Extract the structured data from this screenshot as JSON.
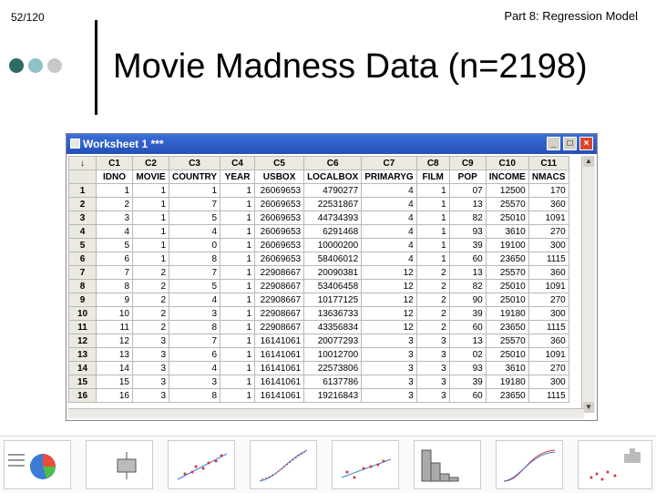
{
  "slide": {
    "number": "52/120",
    "part_title": "Part 8: Regression Model",
    "title": "Movie Madness Data (n=2198)"
  },
  "colors": {
    "dot1": "#2e6b64",
    "dot2": "#8cc2c7",
    "dot3": "#c8c8c8",
    "titlebar": "#2a56c0"
  },
  "worksheet": {
    "title": "Worksheet 1 ***",
    "buttons": {
      "minimize": "_",
      "maximize": "□",
      "close": "×"
    },
    "row_header_arrow": "↓",
    "columns": [
      "C1",
      "C2",
      "C3",
      "C4",
      "C5",
      "C6",
      "C7",
      "C8",
      "C9",
      "C10",
      "C11"
    ],
    "names": [
      "IDNO",
      "MOVIE",
      "COUNTRY",
      "YEAR",
      "USBOX",
      "LOCALBOX",
      "PRIMARYG",
      "FILM",
      "POP",
      "INCOME",
      "NMACS"
    ],
    "rows": [
      [
        "1",
        "1",
        "1",
        "1",
        "1",
        "26069653",
        "4790277",
        "4",
        "1",
        "07",
        "12500",
        "170"
      ],
      [
        "2",
        "2",
        "1",
        "7",
        "1",
        "26069653",
        "22531867",
        "4",
        "1",
        "13",
        "25570",
        "360"
      ],
      [
        "3",
        "3",
        "1",
        "5",
        "1",
        "26069653",
        "44734393",
        "4",
        "1",
        "82",
        "25010",
        "1091"
      ],
      [
        "4",
        "4",
        "1",
        "4",
        "1",
        "26069653",
        "6291468",
        "4",
        "1",
        "93",
        "3610",
        "270"
      ],
      [
        "5",
        "5",
        "1",
        "0",
        "1",
        "26069653",
        "10000200",
        "4",
        "1",
        "39",
        "19100",
        "300"
      ],
      [
        "6",
        "6",
        "1",
        "8",
        "1",
        "26069653",
        "58406012",
        "4",
        "1",
        "60",
        "23650",
        "1115"
      ],
      [
        "7",
        "7",
        "2",
        "7",
        "1",
        "22908667",
        "20090381",
        "12",
        "2",
        "13",
        "25570",
        "360"
      ],
      [
        "8",
        "8",
        "2",
        "5",
        "1",
        "22908667",
        "53406458",
        "12",
        "2",
        "82",
        "25010",
        "1091"
      ],
      [
        "9",
        "9",
        "2",
        "4",
        "1",
        "22908667",
        "10177125",
        "12",
        "2",
        "90",
        "25010",
        "270"
      ],
      [
        "10",
        "10",
        "2",
        "3",
        "1",
        "22908667",
        "13636733",
        "12",
        "2",
        "39",
        "19180",
        "300"
      ],
      [
        "11",
        "11",
        "2",
        "8",
        "1",
        "22908667",
        "43356834",
        "12",
        "2",
        "60",
        "23650",
        "1115"
      ],
      [
        "12",
        "12",
        "3",
        "7",
        "1",
        "16141061",
        "20077293",
        "3",
        "3",
        "13",
        "25570",
        "360"
      ],
      [
        "13",
        "13",
        "3",
        "6",
        "1",
        "16141061",
        "10012700",
        "3",
        "3",
        "02",
        "25010",
        "1091"
      ],
      [
        "14",
        "14",
        "3",
        "4",
        "1",
        "16141061",
        "22573806",
        "3",
        "3",
        "93",
        "3610",
        "270"
      ],
      [
        "15",
        "15",
        "3",
        "3",
        "1",
        "16141061",
        "6137786",
        "3",
        "3",
        "39",
        "19180",
        "300"
      ],
      [
        "16",
        "16",
        "3",
        "8",
        "1",
        "16141061",
        "19216843",
        "3",
        "3",
        "60",
        "23650",
        "1115"
      ]
    ]
  }
}
